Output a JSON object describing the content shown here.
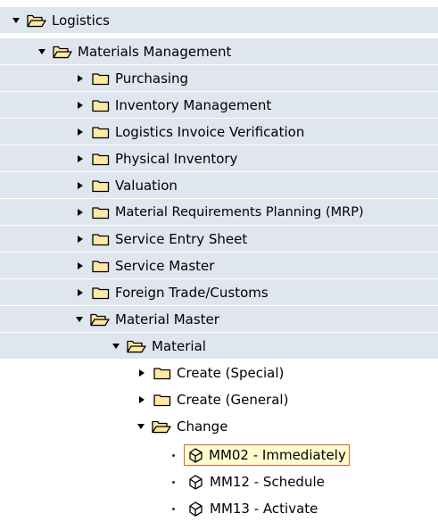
{
  "tree": {
    "logistics": "Logistics",
    "materials_management": "Materials Management",
    "purchasing": "Purchasing",
    "inventory_management": "Inventory Management",
    "logistics_invoice_verification": "Logistics Invoice Verification",
    "physical_inventory": "Physical Inventory",
    "valuation": "Valuation",
    "mrp": "Material Requirements Planning (MRP)",
    "service_entry_sheet": "Service Entry Sheet",
    "service_master": "Service Master",
    "foreign_trade": "Foreign Trade/Customs",
    "material_master": "Material Master",
    "material": "Material",
    "create_special": "Create (Special)",
    "create_general": "Create (General)",
    "change": "Change",
    "mm02": "MM02 - Immediately",
    "mm12": "MM12 - Schedule",
    "mm13": "MM13 - Activate"
  },
  "colors": {
    "row_background": "#dfe6ee",
    "folder_fill": "#fde9a5",
    "selection_border": "#e05c40",
    "selection_background": "#fffdd0"
  },
  "icons": {
    "folder_closed": "folder-icon",
    "folder_open": "folder-open-icon",
    "transaction": "transaction-cube-icon"
  }
}
